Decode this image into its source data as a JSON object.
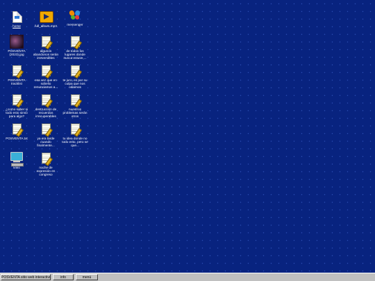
{
  "desktop": {
    "icons": [
      {
        "label": "home",
        "icon": "document-icon"
      },
      {
        "label": "full_album.mp3",
        "icon": "media-file-icon"
      },
      {
        "label": "messenger",
        "icon": "messenger-butterfly-icon"
      },
      {
        "label": "POSVENTA (2023).jpg",
        "icon": "image-thumbnail-icon"
      },
      {
        "label": "algunos abandonos serán irreversibles",
        "icon": "notepad-file-icon"
      },
      {
        "label": "de todos los lugares donde nunca estuve,...",
        "icon": "notepad-file-icon"
      },
      {
        "label": "POSVENTA tracklist",
        "icon": "notepad-file-icon"
      },
      {
        "label": "esa vez que en sobelio renunciamos a...",
        "icon": "notepad-file-icon"
      },
      {
        "label": "te juro, es por su culpa que nos odiamos",
        "icon": "notepad-file-icon"
      },
      {
        "label": "¿como saber si todo esto sirvió para algo?",
        "icon": "notepad-file-icon"
      },
      {
        "label": "destrucción de recuerdos irrecuperables",
        "icon": "notepad-file-icon"
      },
      {
        "label": "nuestros problemas serán otros",
        "icon": "notepad-file-icon"
      },
      {
        "label": "POSVENTA.txt",
        "icon": "notepad-file-icon"
      },
      {
        "label": "ya era tarde cuando finalmente...",
        "icon": "notepad-file-icon"
      },
      {
        "label": "tu idea donde no todo esto, pero se que...",
        "icon": "notepad-file-icon"
      },
      {
        "label": "links",
        "icon": "computer-icon"
      },
      {
        "label": "noche de expresión en congreso",
        "icon": "notepad-file-icon"
      }
    ]
  },
  "taskbar": {
    "buttons": [
      {
        "label": "POSVENTA sitio web interactivo"
      },
      {
        "label": "info"
      },
      {
        "label": "menú"
      }
    ]
  },
  "colors": {
    "desktop_background": "#08237f",
    "taskbar": "#c0c0c0"
  }
}
